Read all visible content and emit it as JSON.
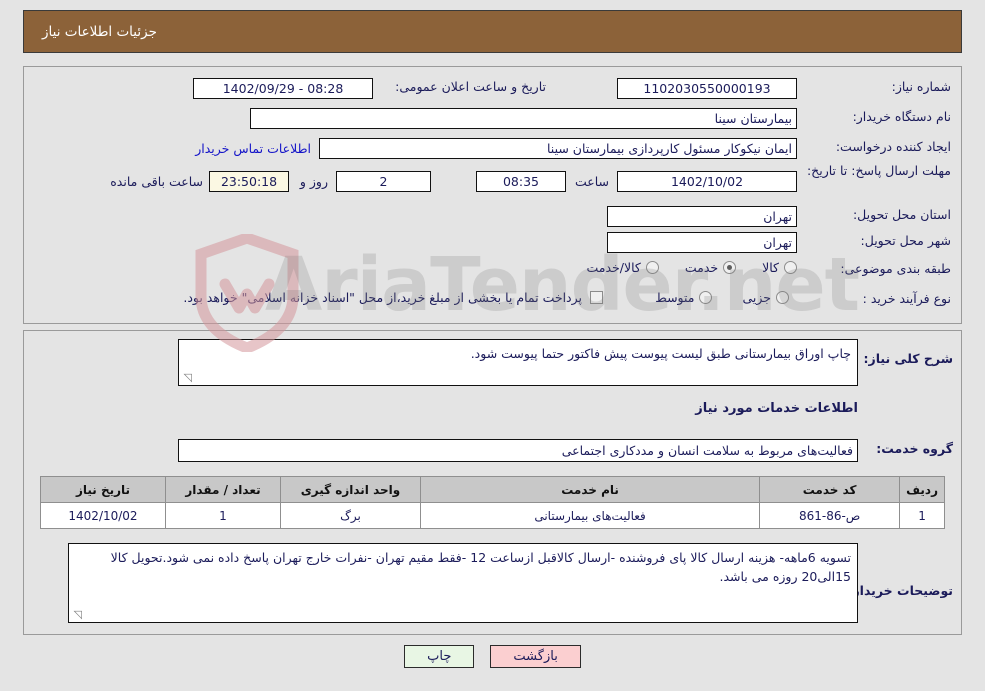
{
  "header": {
    "title": "جزئیات اطلاعات نیاز",
    "bg_color": "#8c6239",
    "text_color": "#ffffff"
  },
  "watermark": {
    "text": "AriaTender.net",
    "shield_color": "#e8c3c6"
  },
  "top_panel": {
    "need_number": {
      "label": "شماره نیاز:",
      "value": "1102030550000193"
    },
    "public_announce": {
      "label": "تاریخ و ساعت اعلان عمومی:",
      "value": "08:28 - 1402/09/29"
    },
    "buyer_org": {
      "label": "نام دستگاه خریدار:",
      "value": "بیمارستان سینا"
    },
    "requester": {
      "label": "ایجاد کننده درخواست:",
      "value": "ایمان نیکوکار مسئول کارپردازی  بیمارستان سینا"
    },
    "buyer_contact_link": "اطلاعات تماس خریدار",
    "deadline": {
      "label": "مهلت ارسال پاسخ: تا تاریخ:",
      "date": "1402/10/02",
      "hour_label": "ساعت",
      "hour": "08:35",
      "days": "2",
      "days_label": "روز و",
      "countdown": "23:50:18",
      "remaining_label": "ساعت باقی مانده"
    },
    "delivery_province": {
      "label": "استان محل تحویل:",
      "value": "تهران"
    },
    "delivery_city": {
      "label": "شهر محل تحویل:",
      "value": "تهران"
    },
    "subject_class": {
      "label": "طبقه بندی موضوعی:",
      "options": [
        {
          "label": "کالا",
          "selected": false
        },
        {
          "label": "خدمت",
          "selected": true
        },
        {
          "label": "کالا/خدمت",
          "selected": false
        }
      ]
    },
    "purchase_type": {
      "label": "نوع فرآیند خرید :",
      "options": [
        {
          "label": "جزیی",
          "selected": false
        },
        {
          "label": "متوسط",
          "selected": false
        }
      ]
    },
    "treasury_note": {
      "checked": false,
      "text": "پرداخت تمام یا بخشی از مبلغ خرید،از محل \"اسناد خزانه اسلامی\" خواهد بود."
    }
  },
  "mid_panel": {
    "general_desc": {
      "label": "شرح کلی نیاز:",
      "value": "چاپ اوراق بیمارستانی طبق لیست پیوست پیش فاکتور حتما پیوست شود."
    },
    "services_heading": "اطلاعات خدمات مورد نیاز",
    "service_group": {
      "label": "گروه خدمت:",
      "value": "فعالیت‌های مربوط به سلامت انسان و مددکاری اجتماعی"
    },
    "table": {
      "columns": [
        "ردیف",
        "کد خدمت",
        "نام خدمت",
        "واحد اندازه گیری",
        "تعداد / مقدار",
        "تاریخ نیاز"
      ],
      "rows": [
        {
          "row_no": "1",
          "service_code": "ص-86-861",
          "service_name": "فعالیت‌های بیمارستانی",
          "unit": "برگ",
          "quantity": "1",
          "need_date": "1402/10/02"
        }
      ]
    },
    "buyer_notes": {
      "label": "توضیحات خریدار:",
      "value": "تسویه 6ماهه- هزینه ارسال کالا پای فروشنده -ارسال کالاقبل ازساعت 12 -فقط مقیم تهران -نفرات خارج تهران پاسخ داده نمی شود.تحویل کالا 15الی20 روزه می باشد."
    }
  },
  "footer": {
    "print_label": "چاپ",
    "back_label": "بازگشت"
  }
}
